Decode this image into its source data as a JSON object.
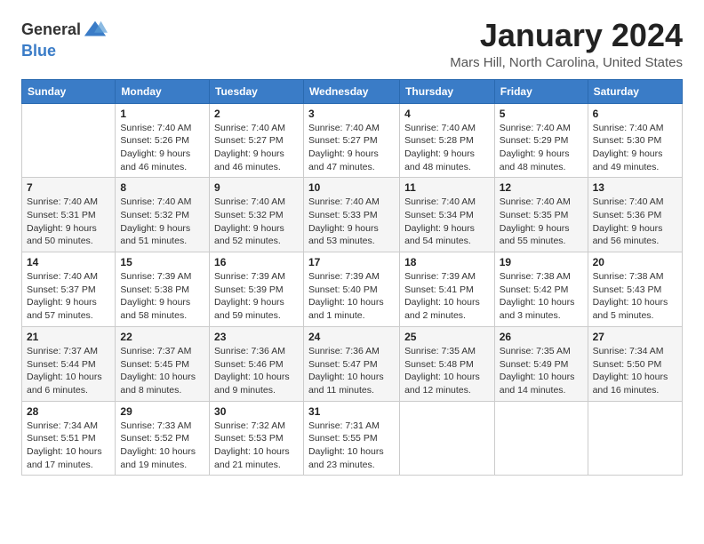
{
  "logo": {
    "general": "General",
    "blue": "Blue"
  },
  "title": "January 2024",
  "subtitle": "Mars Hill, North Carolina, United States",
  "days_of_week": [
    "Sunday",
    "Monday",
    "Tuesday",
    "Wednesday",
    "Thursday",
    "Friday",
    "Saturday"
  ],
  "weeks": [
    [
      {
        "day": "",
        "sunrise": "",
        "sunset": "",
        "daylight": ""
      },
      {
        "day": "1",
        "sunrise": "Sunrise: 7:40 AM",
        "sunset": "Sunset: 5:26 PM",
        "daylight": "Daylight: 9 hours and 46 minutes."
      },
      {
        "day": "2",
        "sunrise": "Sunrise: 7:40 AM",
        "sunset": "Sunset: 5:27 PM",
        "daylight": "Daylight: 9 hours and 46 minutes."
      },
      {
        "day": "3",
        "sunrise": "Sunrise: 7:40 AM",
        "sunset": "Sunset: 5:27 PM",
        "daylight": "Daylight: 9 hours and 47 minutes."
      },
      {
        "day": "4",
        "sunrise": "Sunrise: 7:40 AM",
        "sunset": "Sunset: 5:28 PM",
        "daylight": "Daylight: 9 hours and 48 minutes."
      },
      {
        "day": "5",
        "sunrise": "Sunrise: 7:40 AM",
        "sunset": "Sunset: 5:29 PM",
        "daylight": "Daylight: 9 hours and 48 minutes."
      },
      {
        "day": "6",
        "sunrise": "Sunrise: 7:40 AM",
        "sunset": "Sunset: 5:30 PM",
        "daylight": "Daylight: 9 hours and 49 minutes."
      }
    ],
    [
      {
        "day": "7",
        "sunrise": "Sunrise: 7:40 AM",
        "sunset": "Sunset: 5:31 PM",
        "daylight": "Daylight: 9 hours and 50 minutes."
      },
      {
        "day": "8",
        "sunrise": "Sunrise: 7:40 AM",
        "sunset": "Sunset: 5:32 PM",
        "daylight": "Daylight: 9 hours and 51 minutes."
      },
      {
        "day": "9",
        "sunrise": "Sunrise: 7:40 AM",
        "sunset": "Sunset: 5:32 PM",
        "daylight": "Daylight: 9 hours and 52 minutes."
      },
      {
        "day": "10",
        "sunrise": "Sunrise: 7:40 AM",
        "sunset": "Sunset: 5:33 PM",
        "daylight": "Daylight: 9 hours and 53 minutes."
      },
      {
        "day": "11",
        "sunrise": "Sunrise: 7:40 AM",
        "sunset": "Sunset: 5:34 PM",
        "daylight": "Daylight: 9 hours and 54 minutes."
      },
      {
        "day": "12",
        "sunrise": "Sunrise: 7:40 AM",
        "sunset": "Sunset: 5:35 PM",
        "daylight": "Daylight: 9 hours and 55 minutes."
      },
      {
        "day": "13",
        "sunrise": "Sunrise: 7:40 AM",
        "sunset": "Sunset: 5:36 PM",
        "daylight": "Daylight: 9 hours and 56 minutes."
      }
    ],
    [
      {
        "day": "14",
        "sunrise": "Sunrise: 7:40 AM",
        "sunset": "Sunset: 5:37 PM",
        "daylight": "Daylight: 9 hours and 57 minutes."
      },
      {
        "day": "15",
        "sunrise": "Sunrise: 7:39 AM",
        "sunset": "Sunset: 5:38 PM",
        "daylight": "Daylight: 9 hours and 58 minutes."
      },
      {
        "day": "16",
        "sunrise": "Sunrise: 7:39 AM",
        "sunset": "Sunset: 5:39 PM",
        "daylight": "Daylight: 9 hours and 59 minutes."
      },
      {
        "day": "17",
        "sunrise": "Sunrise: 7:39 AM",
        "sunset": "Sunset: 5:40 PM",
        "daylight": "Daylight: 10 hours and 1 minute."
      },
      {
        "day": "18",
        "sunrise": "Sunrise: 7:39 AM",
        "sunset": "Sunset: 5:41 PM",
        "daylight": "Daylight: 10 hours and 2 minutes."
      },
      {
        "day": "19",
        "sunrise": "Sunrise: 7:38 AM",
        "sunset": "Sunset: 5:42 PM",
        "daylight": "Daylight: 10 hours and 3 minutes."
      },
      {
        "day": "20",
        "sunrise": "Sunrise: 7:38 AM",
        "sunset": "Sunset: 5:43 PM",
        "daylight": "Daylight: 10 hours and 5 minutes."
      }
    ],
    [
      {
        "day": "21",
        "sunrise": "Sunrise: 7:37 AM",
        "sunset": "Sunset: 5:44 PM",
        "daylight": "Daylight: 10 hours and 6 minutes."
      },
      {
        "day": "22",
        "sunrise": "Sunrise: 7:37 AM",
        "sunset": "Sunset: 5:45 PM",
        "daylight": "Daylight: 10 hours and 8 minutes."
      },
      {
        "day": "23",
        "sunrise": "Sunrise: 7:36 AM",
        "sunset": "Sunset: 5:46 PM",
        "daylight": "Daylight: 10 hours and 9 minutes."
      },
      {
        "day": "24",
        "sunrise": "Sunrise: 7:36 AM",
        "sunset": "Sunset: 5:47 PM",
        "daylight": "Daylight: 10 hours and 11 minutes."
      },
      {
        "day": "25",
        "sunrise": "Sunrise: 7:35 AM",
        "sunset": "Sunset: 5:48 PM",
        "daylight": "Daylight: 10 hours and 12 minutes."
      },
      {
        "day": "26",
        "sunrise": "Sunrise: 7:35 AM",
        "sunset": "Sunset: 5:49 PM",
        "daylight": "Daylight: 10 hours and 14 minutes."
      },
      {
        "day": "27",
        "sunrise": "Sunrise: 7:34 AM",
        "sunset": "Sunset: 5:50 PM",
        "daylight": "Daylight: 10 hours and 16 minutes."
      }
    ],
    [
      {
        "day": "28",
        "sunrise": "Sunrise: 7:34 AM",
        "sunset": "Sunset: 5:51 PM",
        "daylight": "Daylight: 10 hours and 17 minutes."
      },
      {
        "day": "29",
        "sunrise": "Sunrise: 7:33 AM",
        "sunset": "Sunset: 5:52 PM",
        "daylight": "Daylight: 10 hours and 19 minutes."
      },
      {
        "day": "30",
        "sunrise": "Sunrise: 7:32 AM",
        "sunset": "Sunset: 5:53 PM",
        "daylight": "Daylight: 10 hours and 21 minutes."
      },
      {
        "day": "31",
        "sunrise": "Sunrise: 7:31 AM",
        "sunset": "Sunset: 5:55 PM",
        "daylight": "Daylight: 10 hours and 23 minutes."
      },
      {
        "day": "",
        "sunrise": "",
        "sunset": "",
        "daylight": ""
      },
      {
        "day": "",
        "sunrise": "",
        "sunset": "",
        "daylight": ""
      },
      {
        "day": "",
        "sunrise": "",
        "sunset": "",
        "daylight": ""
      }
    ]
  ]
}
